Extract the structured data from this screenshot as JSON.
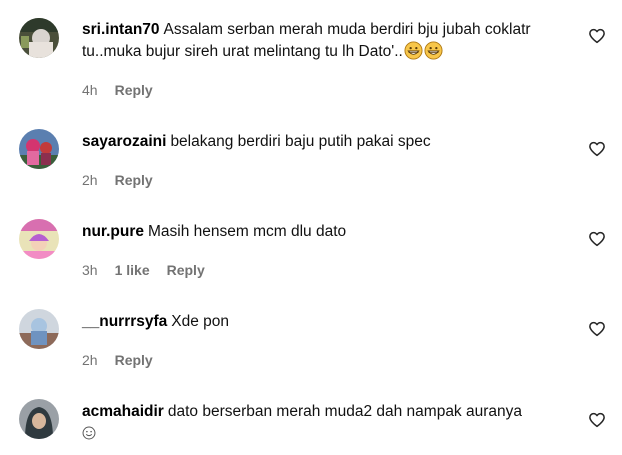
{
  "comments": [
    {
      "username": "sri.intan70",
      "text": "Assalam serban merah muda berdiri bju jubah coklatr tu..muka bujur sireh urat melintang tu lh Dato'..",
      "emoji": [
        "grinning-face-icon",
        "grinning-face-icon"
      ],
      "time": "4h",
      "likes": "",
      "reply_label": "Reply"
    },
    {
      "username": "sayarozaini",
      "text": "belakang berdiri baju putih pakai spec",
      "emoji": [],
      "time": "2h",
      "likes": "",
      "reply_label": "Reply"
    },
    {
      "username": "nur.pure",
      "text": "Masih hensem mcm dlu dato",
      "emoji": [],
      "time": "3h",
      "likes": "1 like",
      "reply_label": "Reply"
    },
    {
      "username": "__nurrrsyfa",
      "text": "Xde pon",
      "emoji": [],
      "time": "2h",
      "likes": "",
      "reply_label": "Reply"
    },
    {
      "username": "acmahaidir",
      "text": "dato berserban merah muda2 dah nampak auranya",
      "emoji": [
        "smiling-face-icon"
      ],
      "time": "",
      "likes": "",
      "reply_label": ""
    }
  ],
  "colors": {
    "text": "#000000",
    "meta": "#737373",
    "icon": "#262626"
  }
}
